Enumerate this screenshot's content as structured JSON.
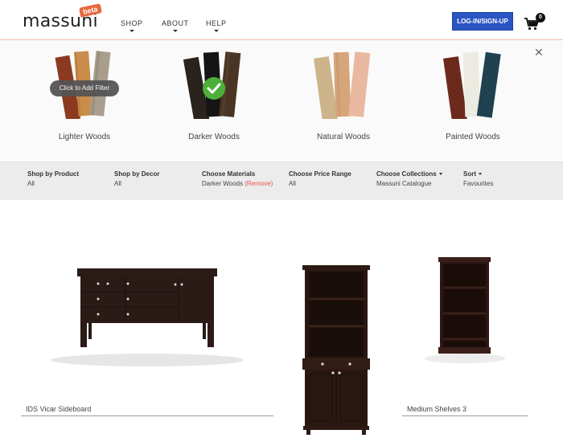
{
  "header": {
    "logo": "massuni",
    "beta": "beta",
    "nav": [
      {
        "label": "SHOP"
      },
      {
        "label": "ABOUT"
      },
      {
        "label": "HELP"
      }
    ],
    "login_label": "LOG-IN/SIGN-UP",
    "cart_count": "0",
    "accent_color": "#2a55c3",
    "brand_color": "#e8663d"
  },
  "filter_panel": {
    "tooltip": "Click to Add Filter",
    "woods": [
      {
        "label": "Lighter Woods",
        "selected": false
      },
      {
        "label": "Darker Woods",
        "selected": true
      },
      {
        "label": "Natural Woods",
        "selected": false
      },
      {
        "label": "Painted Woods",
        "selected": false
      }
    ]
  },
  "filter_bar": {
    "shop_by_product": {
      "title": "Shop by Product",
      "value": "All"
    },
    "shop_by_decor": {
      "title": "Shop by Decor",
      "value": "All"
    },
    "materials": {
      "title": "Choose Materials",
      "value": "Darker Woods",
      "remove": "(Remove)"
    },
    "price": {
      "title": "Choose Price Range",
      "value": "All"
    },
    "collections": {
      "title": "Choose Collections",
      "value": "Massuni Catalogue"
    },
    "sort": {
      "title": "Sort",
      "value": "Favourites"
    }
  },
  "products": [
    {
      "name": "IDS Vicar Sideboard"
    },
    {
      "name": ""
    },
    {
      "name": "Medium Shelves 3"
    }
  ]
}
